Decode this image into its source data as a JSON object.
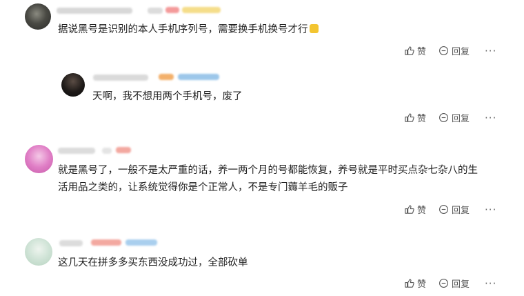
{
  "comments": [
    {
      "text": "据说黑号是识别的本人手机序列号，需要换手机换号才行",
      "like_label": "赞",
      "reply_label": "回复",
      "more_label": "···"
    },
    {
      "text": "天啊，我不想用两个手机号，废了",
      "like_label": "赞",
      "reply_label": "回复",
      "more_label": "···"
    },
    {
      "text_line1": "就是黑号了，一般不是太严重的话，养一两个月的号都能恢复，养号就是平时买点杂七杂八的生",
      "text_line2": "活用品之类的，让系统觉得你是个正常人，不是专门薅羊毛的贩子",
      "like_label": "赞",
      "reply_label": "回复",
      "more_label": "···"
    },
    {
      "text": "这几天在拼多多买东西没成功过，全部砍单",
      "like_label": "赞",
      "reply_label": "回复",
      "more_label": "···"
    }
  ],
  "colors": {
    "avatar1": "#5c5c5c",
    "avatar2": "#2e2e2e",
    "avatar3": "#e58bc8",
    "avatar4": "#d7e7dc",
    "icon": "#555555",
    "text": "#222222"
  }
}
